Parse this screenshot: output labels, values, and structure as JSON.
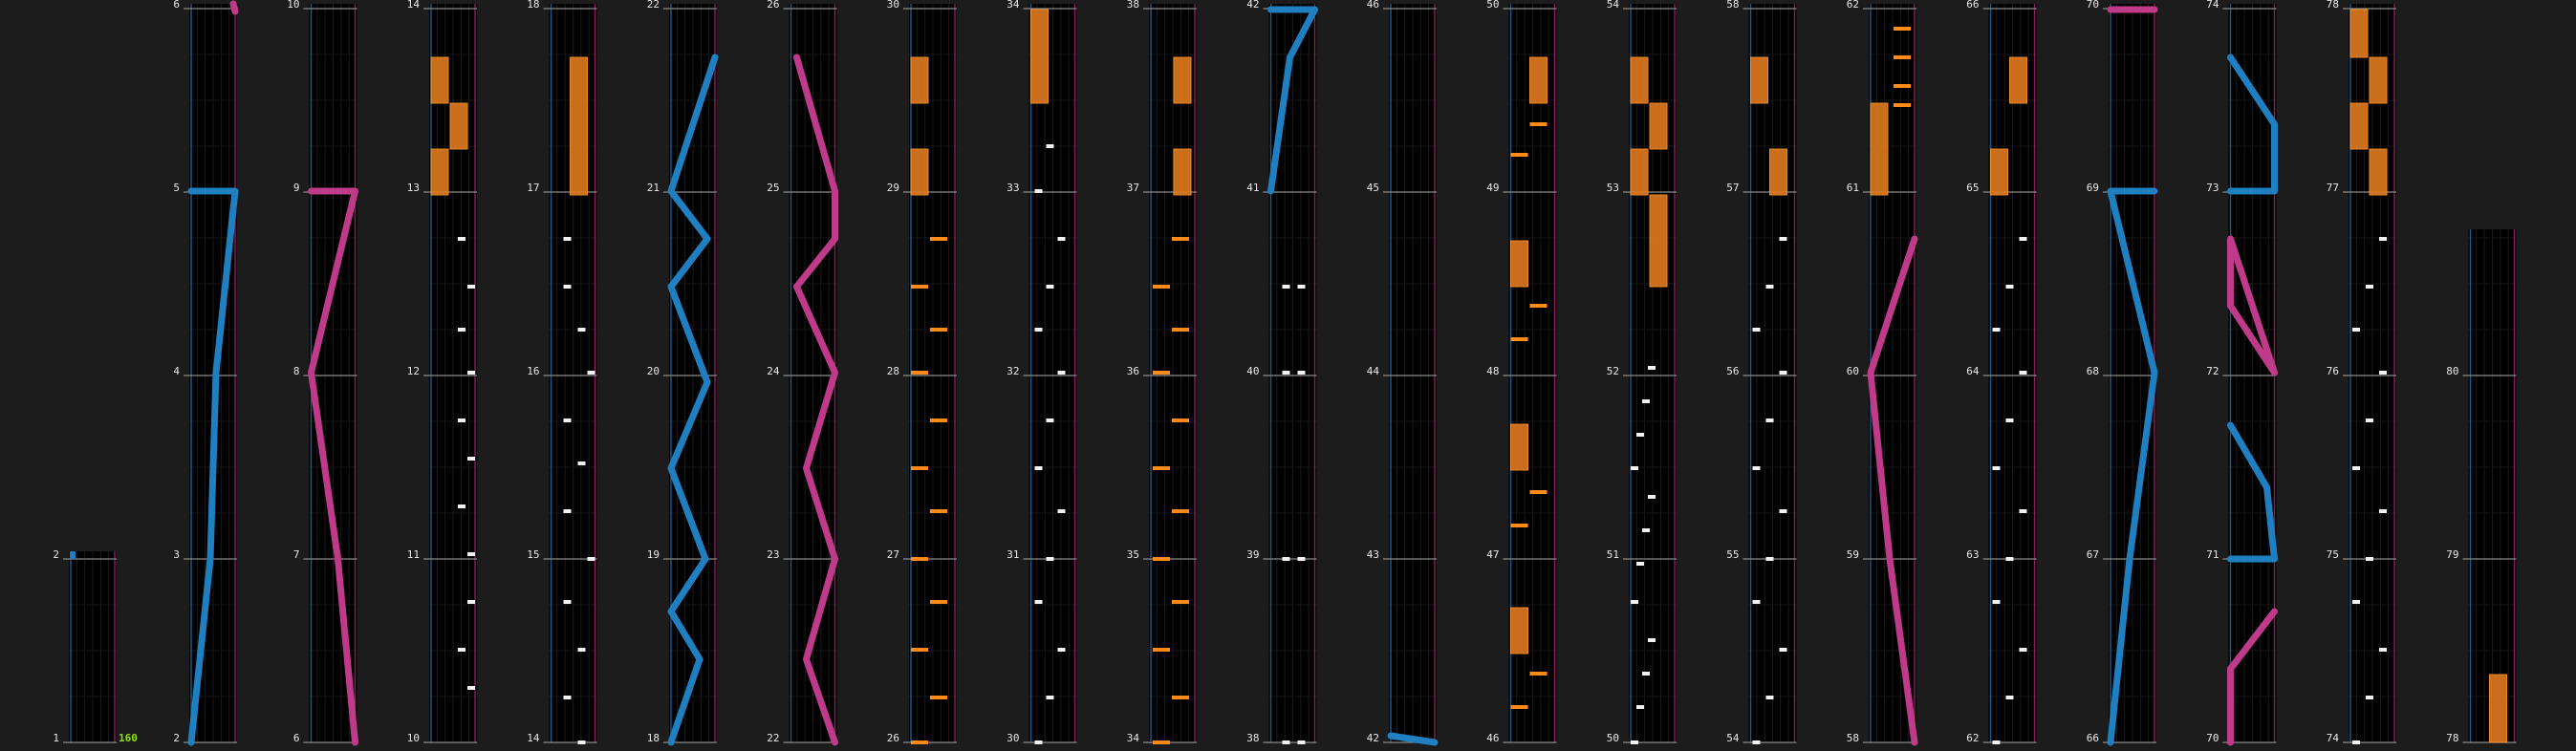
{
  "chart": {
    "bpm_label": "160",
    "first_column_measures": [
      "1",
      "2"
    ],
    "columns": [
      {
        "measures": [
          "2",
          "3",
          "4",
          "5",
          "6"
        ]
      },
      {
        "measures": [
          "6",
          "7",
          "8",
          "9",
          "10"
        ]
      },
      {
        "measures": [
          "10",
          "11",
          "12",
          "13",
          "14"
        ]
      },
      {
        "measures": [
          "14",
          "15",
          "16",
          "17",
          "18"
        ]
      },
      {
        "measures": [
          "18",
          "19",
          "20",
          "21",
          "22"
        ]
      },
      {
        "measures": [
          "22",
          "23",
          "24",
          "25",
          "26"
        ]
      },
      {
        "measures": [
          "26",
          "27",
          "28",
          "29",
          "30"
        ]
      },
      {
        "measures": [
          "30",
          "31",
          "32",
          "33",
          "34"
        ]
      },
      {
        "measures": [
          "34",
          "35",
          "36",
          "37",
          "38"
        ]
      },
      {
        "measures": [
          "38",
          "39",
          "40",
          "41",
          "42"
        ]
      },
      {
        "measures": [
          "42",
          "43",
          "44",
          "45",
          "46"
        ]
      },
      {
        "measures": [
          "46",
          "47",
          "48",
          "49",
          "50"
        ]
      },
      {
        "measures": [
          "50",
          "51",
          "52",
          "53",
          "54"
        ]
      },
      {
        "measures": [
          "54",
          "55",
          "56",
          "57",
          "58"
        ]
      },
      {
        "measures": [
          "58",
          "59",
          "60",
          "61",
          "62"
        ]
      },
      {
        "measures": [
          "62",
          "63",
          "64",
          "65",
          "66"
        ]
      },
      {
        "measures": [
          "66",
          "67",
          "68",
          "69",
          "70"
        ]
      },
      {
        "measures": [
          "70",
          "71",
          "72",
          "73",
          "74"
        ]
      },
      {
        "measures": [
          "74",
          "75",
          "76",
          "77",
          "78"
        ]
      },
      {
        "measures": [
          "78",
          "79",
          "80"
        ]
      }
    ]
  },
  "colors": {
    "background": "#1c1c1c",
    "lane": "#000000",
    "laser_left": "#1f7fc0",
    "laser_right": "#c03a8a",
    "fx": "#ff8a1a",
    "bt": "#f2f2f2",
    "bpm": "#8fe000"
  }
}
